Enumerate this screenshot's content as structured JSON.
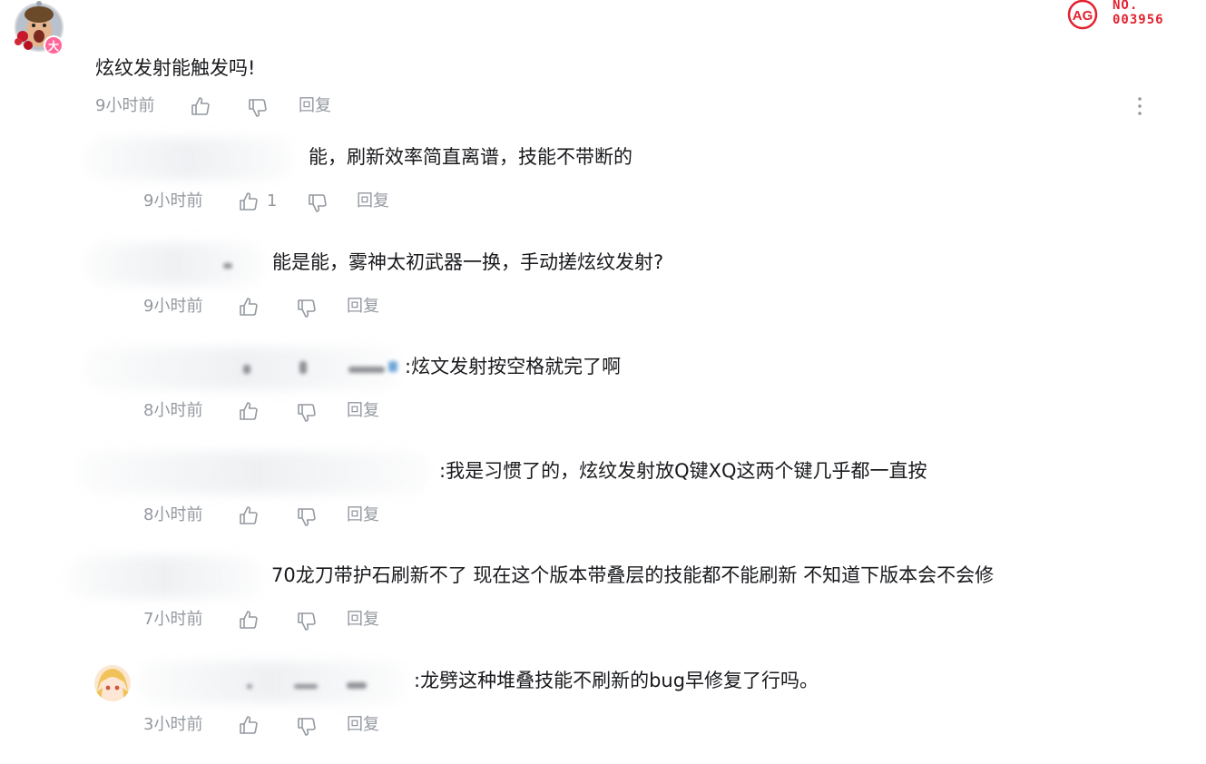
{
  "watermark": {
    "logo_text": "AG",
    "line1": "NO.",
    "line2": "003956"
  },
  "main_comment": {
    "badge": "大",
    "text": "炫纹发射能触发吗!",
    "time": "9小时前",
    "reply_label": "回复"
  },
  "replies": [
    {
      "prefix": "",
      "text": "能，刷新效率简直离谱，技能不带断的",
      "time": "9小时前",
      "likes": "1",
      "reply_label": "回复"
    },
    {
      "prefix": "",
      "text": "能是能，雾神太初武器一换，手动搓炫纹发射?",
      "time": "9小时前",
      "likes": "",
      "reply_label": "回复"
    },
    {
      "prefix": "",
      "text": ":炫文发射按空格就完了啊",
      "time": "8小时前",
      "likes": "",
      "reply_label": "回复"
    },
    {
      "prefix": "",
      "text": ":我是习惯了的，炫纹发射放Q键XQ这两个键几乎都一直按",
      "time": "8小时前",
      "likes": "",
      "reply_label": "回复"
    },
    {
      "prefix": "",
      "text": "70龙刀带护石刷新不了 现在这个版本带叠层的技能都不能刷新 不知道下版本会不会修",
      "time": "7小时前",
      "likes": "",
      "reply_label": "回复"
    },
    {
      "prefix": "",
      "text": ":龙劈这种堆叠技能不刷新的bug早修复了行吗。",
      "time": "3小时前",
      "likes": "",
      "reply_label": "回复"
    }
  ],
  "icons": {
    "like": "thumbs-up-icon",
    "dislike": "thumbs-down-icon",
    "more": "more-vertical-icon"
  },
  "colors": {
    "text": "#18191c",
    "meta": "#9499a0",
    "watermark": "#e3222f",
    "badge": "#ff6699"
  }
}
